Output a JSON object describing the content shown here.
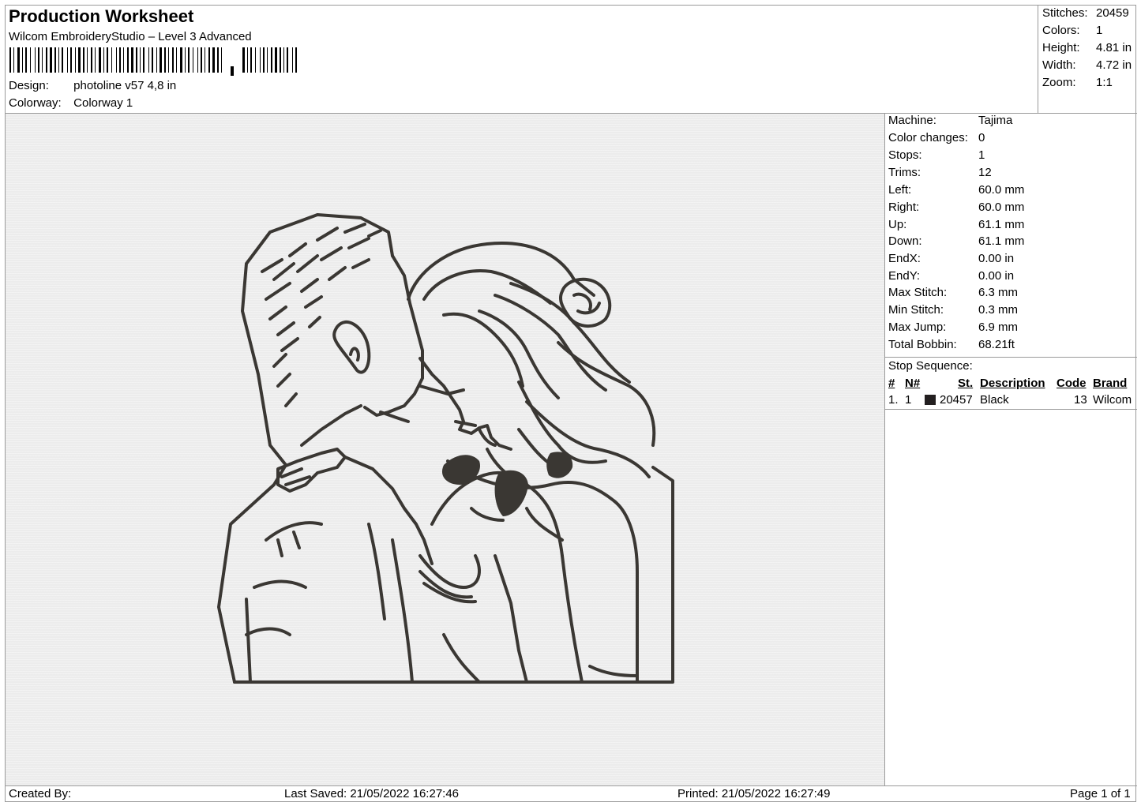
{
  "header": {
    "title": "Production Worksheet",
    "subtitle": "Wilcom EmbroideryStudio – Level 3 Advanced",
    "design_label": "Design:",
    "design_value": "photoline v57 4,8 in",
    "colorway_label": "Colorway:",
    "colorway_value": "Colorway 1"
  },
  "summary": {
    "stitches_label": "Stitches:",
    "stitches_value": "20459",
    "colors_label": "Colors:",
    "colors_value": "1",
    "height_label": "Height:",
    "height_value": "4.81 in",
    "width_label": "Width:",
    "width_value": "4.72 in",
    "zoom_label": "Zoom:",
    "zoom_value": "1:1"
  },
  "machine": {
    "machine_label": "Machine:",
    "machine_value": "Tajima",
    "color_changes_label": "Color changes:",
    "color_changes_value": "0",
    "stops_label": "Stops:",
    "stops_value": "1",
    "trims_label": "Trims:",
    "trims_value": "12",
    "left_label": "Left:",
    "left_value": "60.0 mm",
    "right_label": "Right:",
    "right_value": "60.0 mm",
    "up_label": "Up:",
    "up_value": "61.1 mm",
    "down_label": "Down:",
    "down_value": "61.1 mm",
    "endx_label": "EndX:",
    "endx_value": "0.00 in",
    "endy_label": "EndY:",
    "endy_value": "0.00 in",
    "max_stitch_label": "Max Stitch:",
    "max_stitch_value": "6.3 mm",
    "min_stitch_label": "Min Stitch:",
    "min_stitch_value": "0.3 mm",
    "max_jump_label": "Max Jump:",
    "max_jump_value": "6.9 mm",
    "total_bobbin_label": "Total Bobbin:",
    "total_bobbin_value": "68.21ft"
  },
  "stop_sequence": {
    "title": "Stop Sequence:",
    "headers": {
      "num": "#",
      "n": "N#",
      "st": "St.",
      "description": "Description",
      "code": "Code",
      "brand": "Brand"
    },
    "rows": [
      {
        "num": "1.",
        "n": "1",
        "color": "#231f20",
        "st": "20457",
        "description": "Black",
        "code": "13",
        "brand": "Wilcom"
      }
    ]
  },
  "footer": {
    "created_by": "Created By:",
    "last_saved": "Last Saved: 21/05/2022 16:27:46",
    "printed": "Printed: 21/05/2022 16:27:49",
    "page": "Page 1 of 1"
  },
  "colors": {
    "thread": "#3a3733",
    "canvas": "#ececec",
    "border": "#9a9a9a"
  }
}
